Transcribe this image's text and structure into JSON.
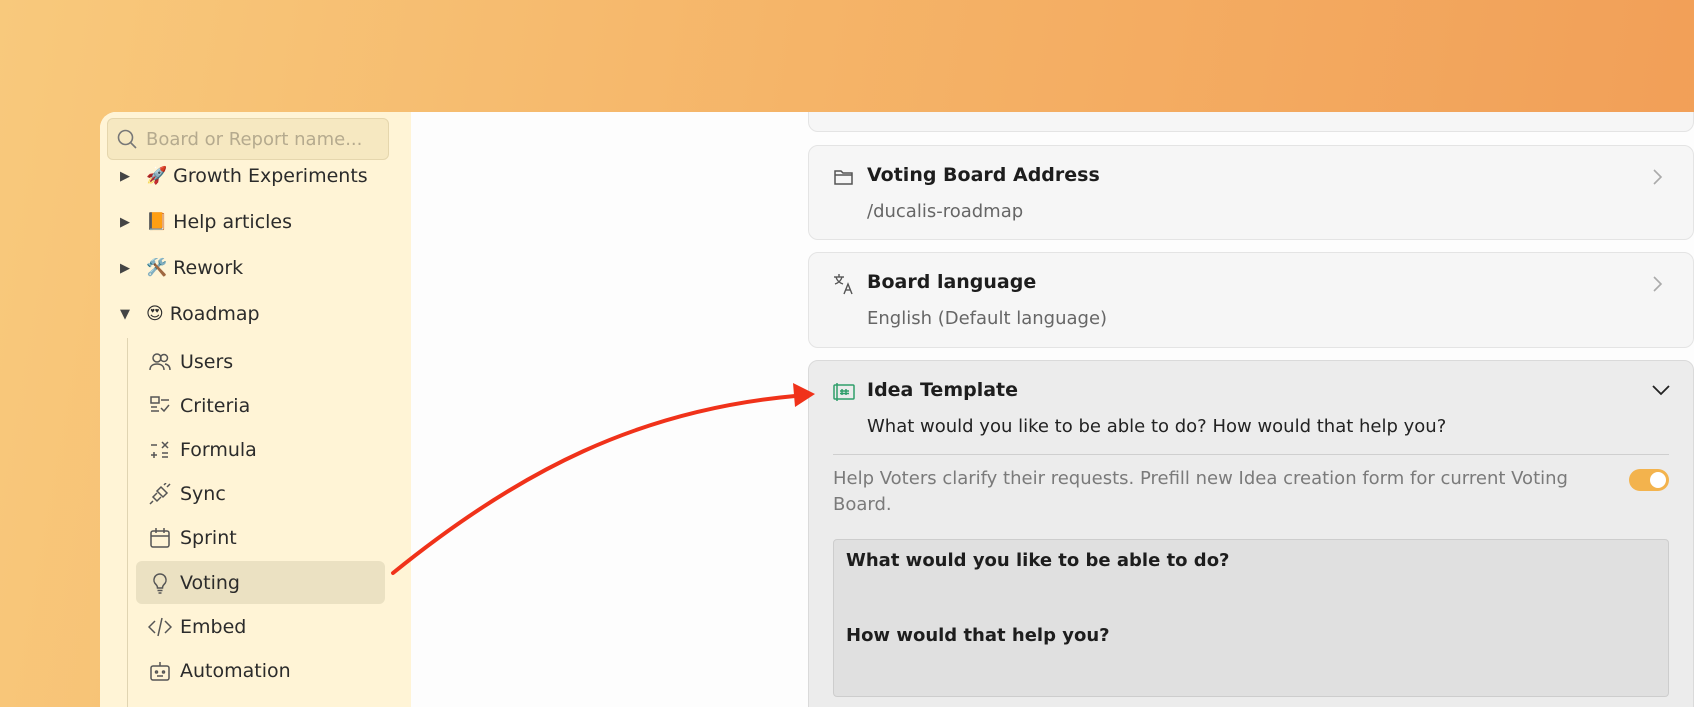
{
  "search": {
    "placeholder": "Board or Report name..."
  },
  "tree": [
    {
      "label": "Growth Experiments",
      "emoji": "🚀",
      "expanded": false
    },
    {
      "label": "Help articles",
      "emoji": "📙",
      "expanded": false
    },
    {
      "label": "Rework",
      "emoji": "🛠️",
      "expanded": false
    },
    {
      "label": "Roadmap",
      "emoji": "😍",
      "expanded": true
    }
  ],
  "roadmap_items": [
    {
      "label": "Users",
      "icon": "users-icon"
    },
    {
      "label": "Criteria",
      "icon": "criteria-icon"
    },
    {
      "label": "Formula",
      "icon": "formula-icon"
    },
    {
      "label": "Sync",
      "icon": "sync-icon"
    },
    {
      "label": "Sprint",
      "icon": "calendar-icon"
    },
    {
      "label": "Voting",
      "icon": "lightbulb-icon",
      "active": true
    },
    {
      "label": "Embed",
      "icon": "code-icon"
    },
    {
      "label": "Automation",
      "icon": "robot-icon"
    }
  ],
  "cards": {
    "address": {
      "title": "Voting Board Address",
      "value": "/ducalis-roadmap",
      "icon": "folder-icon"
    },
    "language": {
      "title": "Board language",
      "value": "English (Default language)",
      "icon": "translate-icon"
    },
    "template": {
      "title": "Idea Template",
      "value": "What would you like to be able to do? How would that help you?",
      "icon": "template-icon",
      "help": "Help Voters clarify their requests. Prefill new Idea creation form for current Voting Board.",
      "enabled": true,
      "lines": [
        "What would you like to be able to do?",
        "How would that help you?"
      ]
    }
  },
  "colors": {
    "accent": "#f3b34d",
    "arrow": "#f0321a",
    "template_icon": "#2e9e6a"
  }
}
